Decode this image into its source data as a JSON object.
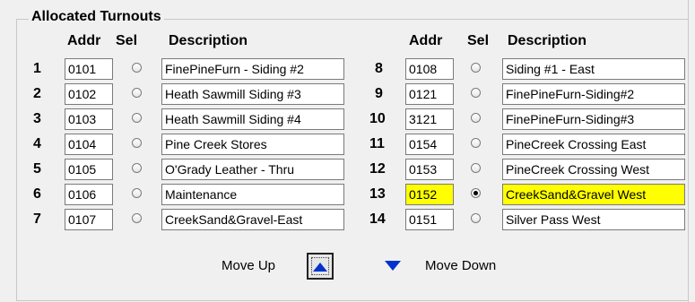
{
  "group_title": "Allocated Turnouts",
  "headers": {
    "addr": "Addr",
    "sel": "Sel",
    "description": "Description"
  },
  "left_rows": [
    {
      "num": "1",
      "addr": "0101",
      "selected": false,
      "description": "FinePineFurn - Siding #2"
    },
    {
      "num": "2",
      "addr": "0102",
      "selected": false,
      "description": "Heath Sawmill Siding #3"
    },
    {
      "num": "3",
      "addr": "0103",
      "selected": false,
      "description": "Heath Sawmill Siding #4"
    },
    {
      "num": "4",
      "addr": "0104",
      "selected": false,
      "description": "Pine Creek Stores"
    },
    {
      "num": "5",
      "addr": "0105",
      "selected": false,
      "description": "O'Grady Leather - Thru"
    },
    {
      "num": "6",
      "addr": "0106",
      "selected": false,
      "description": "Maintenance"
    },
    {
      "num": "7",
      "addr": "0107",
      "selected": false,
      "description": "CreekSand&Gravel-East"
    }
  ],
  "right_rows": [
    {
      "num": "8",
      "addr": "0108",
      "selected": false,
      "description": "Siding #1 - East"
    },
    {
      "num": "9",
      "addr": "0121",
      "selected": false,
      "description": "FinePineFurn-Siding#2"
    },
    {
      "num": "10",
      "addr": "3121",
      "selected": false,
      "description": "FinePineFurn-Siding#3"
    },
    {
      "num": "11",
      "addr": "0154",
      "selected": false,
      "description": "PineCreek Crossing East"
    },
    {
      "num": "12",
      "addr": "0153",
      "selected": false,
      "description": "PineCreek Crossing West"
    },
    {
      "num": "13",
      "addr": "0152",
      "selected": true,
      "description": "CreekSand&Gravel West"
    },
    {
      "num": "14",
      "addr": "0151",
      "selected": false,
      "description": "Silver Pass West"
    }
  ],
  "move_up_label": "Move Up",
  "move_down_label": "Move Down",
  "icons": {
    "move_up": "up-arrow-icon",
    "move_down": "down-arrow-icon"
  },
  "colors": {
    "highlight": "#ffff00",
    "arrow": "#0033cc"
  }
}
